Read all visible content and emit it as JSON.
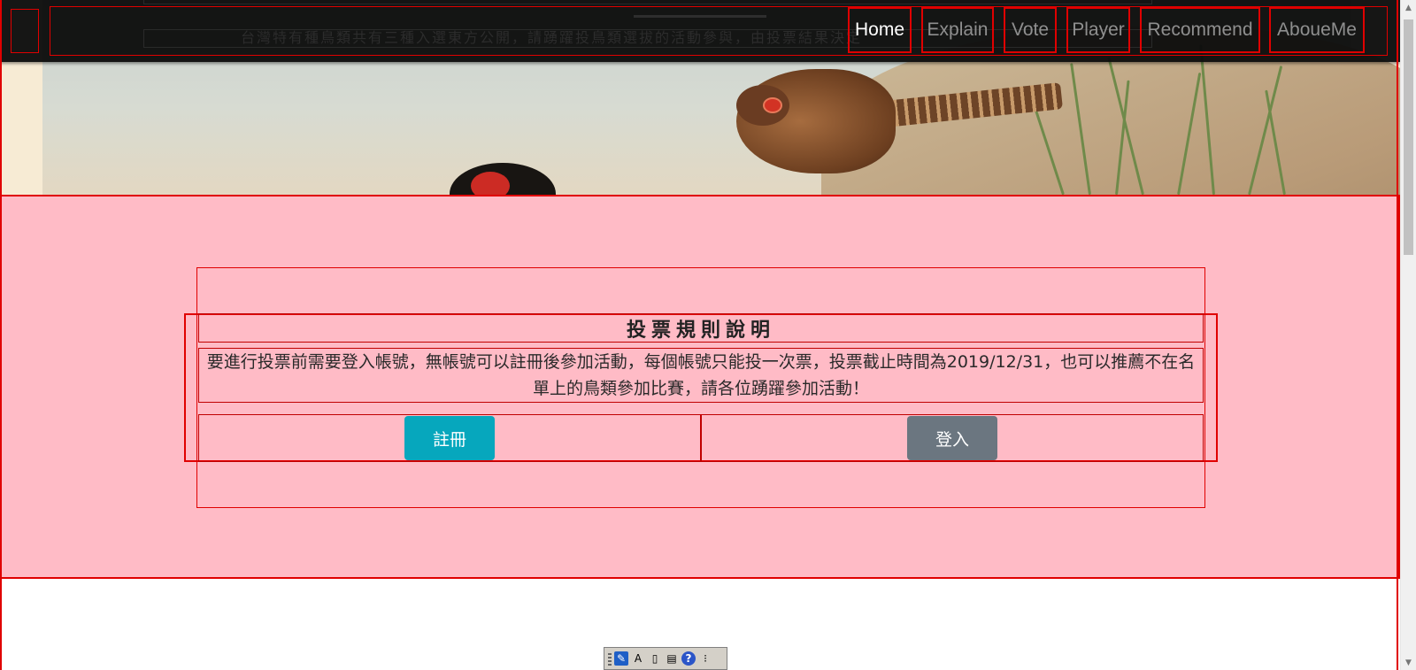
{
  "nav": {
    "items": [
      {
        "label": "Home",
        "active": true
      },
      {
        "label": "Explain",
        "active": false
      },
      {
        "label": "Vote",
        "active": false
      },
      {
        "label": "Player",
        "active": false
      },
      {
        "label": "Recommend",
        "active": false
      },
      {
        "label": "AboueMe",
        "active": false
      }
    ],
    "background_text": "台灣特有種鳥類共有三種入選東方公開，請踴躍投鳥類選拔的活動參與，由投票結果決定"
  },
  "rules": {
    "title": "投票規則說明",
    "body": "要進行投票前需要登入帳號，無帳號可以註冊後參加活動，每個帳號只能投一次票，投票截止時間為2019/12/31，也可以推薦不在名單上的鳥類參加比賽，請各位踴躍參加活動！",
    "register_label": "註冊",
    "login_label": "登入"
  },
  "ime_toolbar": {
    "mode_label": "A"
  },
  "colors": {
    "pink_section": "#ffbbc6",
    "register_button": "#06a7bd",
    "login_button": "#6b7680",
    "navbar": "#0c0c0c",
    "debug_outline": "#e00000"
  }
}
